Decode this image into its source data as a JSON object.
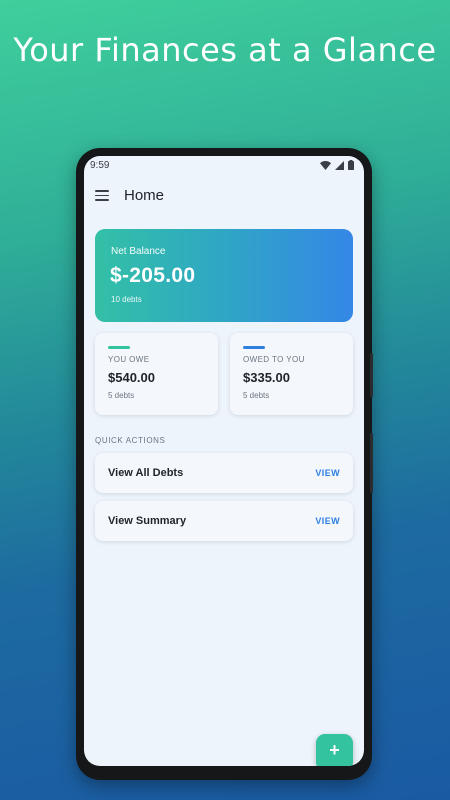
{
  "promo": {
    "headline": "Your Finances at a Glance"
  },
  "status_bar": {
    "time": "9:59"
  },
  "app_bar": {
    "title": "Home",
    "menu_icon": "hamburger-menu-icon"
  },
  "balance_card": {
    "label": "Net Balance",
    "amount": "$-205.00",
    "count": "10 debts",
    "gradient": [
      "#33c0a6",
      "#3587e6"
    ]
  },
  "summary_cards": [
    {
      "label": "YOU OWE",
      "amount": "$540.00",
      "count": "5 debts",
      "accent": "#34c39f"
    },
    {
      "label": "OWED TO YOU",
      "amount": "$335.00",
      "count": "5 debts",
      "accent": "#2f7fe0"
    }
  ],
  "quick_actions": {
    "header": "QUICK ACTIONS",
    "items": [
      {
        "label": "View All Debts",
        "link": "VIEW"
      },
      {
        "label": "View Summary",
        "link": "VIEW"
      }
    ]
  },
  "fab": {
    "label": "+",
    "icon": "plus-icon",
    "color": "#34c39f"
  }
}
